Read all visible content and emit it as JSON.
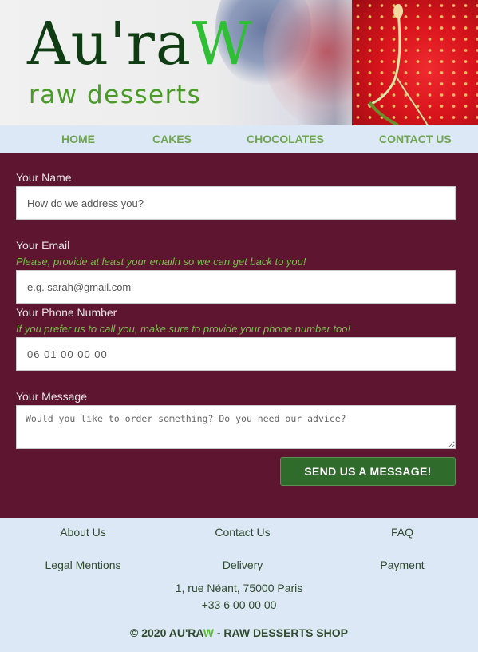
{
  "header": {
    "logo_main": "Au'ra",
    "logo_accent": "W",
    "tagline": "raw desserts"
  },
  "nav": {
    "items": [
      "HOME",
      "CAKES",
      "CHOCOLATES",
      "CONTACT US"
    ]
  },
  "form": {
    "name": {
      "label": "Your Name",
      "placeholder": "How do we address you?"
    },
    "email": {
      "label": "Your Email",
      "hint": "Please, provide at least your emailn so we can get back to you!",
      "placeholder": "e.g. sarah@gmail.com"
    },
    "phone": {
      "label": "Your Phone Number",
      "hint": "If you prefer us to call you, make sure to provide your phone number too!",
      "placeholder": "06 01 00 00 00"
    },
    "message": {
      "label": "Your Message",
      "placeholder": "Would you like to order something? Do you need our advice?"
    },
    "submit_label": "SEND US A MESSAGE!"
  },
  "footer": {
    "links": [
      "About Us",
      "Contact Us",
      "FAQ",
      "Legal Mentions",
      "Delivery",
      "Payment"
    ],
    "address": "1, rue Néant, 75000 Paris",
    "phone": "+33 6 00 00 00",
    "copyright_prefix": "© 2020 AU'RA",
    "copyright_accent": "W",
    "copyright_suffix": " - RAW DESSERTS SHOP"
  },
  "colors": {
    "form_background": "#5e1530",
    "nav_background": "#dce8f5",
    "nav_link": "#6fa54f",
    "hint_text": "#79c04a",
    "button": "#2f6b2b",
    "logo_dark": "#0f3c12",
    "logo_accent": "#2fbf34"
  }
}
